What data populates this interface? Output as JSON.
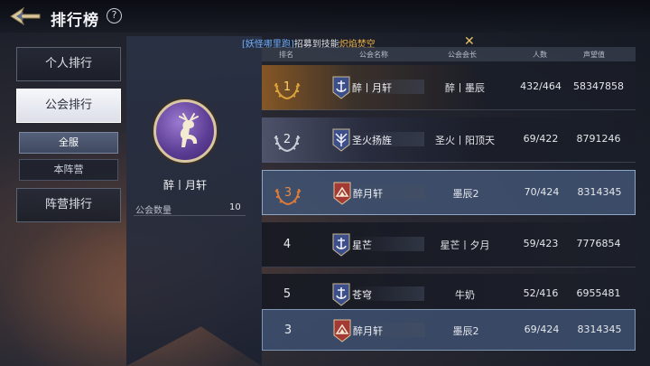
{
  "header": {
    "title": "排行榜",
    "help": "?"
  },
  "notice": {
    "prefix": "[妖怪哪里跑]",
    "middle": "招募到技能",
    "skill": "炽焰焚空"
  },
  "nav": {
    "personal": "个人排行",
    "guild": "公会排行",
    "all_server": "全服",
    "own_camp": "本阵营",
    "camp": "阵营排行"
  },
  "my_guild": {
    "name": "醉丨月轩",
    "count_label": "公会数量",
    "count_value": "10"
  },
  "columns": [
    "排名",
    "公会名称",
    "公会会长",
    "人数",
    "声望值"
  ],
  "rows": [
    {
      "rank": "1",
      "name": "醉丨月轩",
      "leader": "醉丨墨辰",
      "members": "432/464",
      "prestige": "58347858",
      "emblem": "anchor-emblem",
      "emblem_color": "#3d4f8a"
    },
    {
      "rank": "2",
      "name": "圣火扬旌",
      "leader": "圣火丨阳顶天",
      "members": "69/422",
      "prestige": "8791246",
      "emblem": "wings-emblem",
      "emblem_color": "#3d4f8a"
    },
    {
      "rank": "3",
      "name": "醉月轩",
      "leader": "墨辰2",
      "members": "70/424",
      "prestige": "8314345",
      "emblem": "flame-emblem",
      "emblem_color": "#a33a34"
    },
    {
      "rank": "4",
      "name": "星芒",
      "leader": "星芒丨夕月",
      "members": "59/423",
      "prestige": "7776854",
      "emblem": "anchor-emblem",
      "emblem_color": "#3d4f8a"
    },
    {
      "rank": "5",
      "name": "苍穹",
      "leader": "牛奶",
      "members": "52/416",
      "prestige": "6955481",
      "emblem": "anchor-emblem",
      "emblem_color": "#3d4f8a"
    }
  ],
  "my_row": {
    "rank": "3",
    "name": "醉月轩",
    "leader": "墨辰2",
    "members": "69/424",
    "prestige": "8314345",
    "emblem": "flame-emblem",
    "emblem_color": "#a33a34"
  },
  "colors": {
    "gold": "#ffd46a",
    "bronze": "#e58a4a",
    "accent": "#6fb0ff",
    "skill": "#f0b247"
  }
}
